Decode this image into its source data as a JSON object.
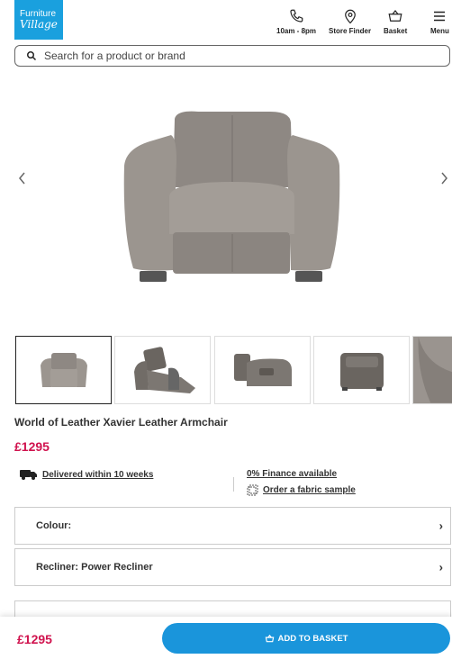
{
  "header": {
    "logo_line1": "Furniture",
    "logo_line2": "Village",
    "phone_label": "10am - 8pm",
    "store_label": "Store Finder",
    "basket_label": "Basket",
    "menu_label": "Menu"
  },
  "search": {
    "placeholder": "Search for a product or brand"
  },
  "product": {
    "title": "World of Leather Xavier Leather Armchair",
    "price": "£1295",
    "delivery": "Delivered within 10 weeks",
    "finance": "0% Finance available",
    "fabric_sample": "Order a fabric sample"
  },
  "options": {
    "colour_label": "Colour:",
    "recliner_label": "Recliner: Power Recliner"
  },
  "footer": {
    "price": "£1295",
    "add_to_basket": "ADD TO BASKET"
  },
  "colors": {
    "brand": "#1aa0de",
    "price": "#d0134e",
    "button": "#1a95db"
  }
}
